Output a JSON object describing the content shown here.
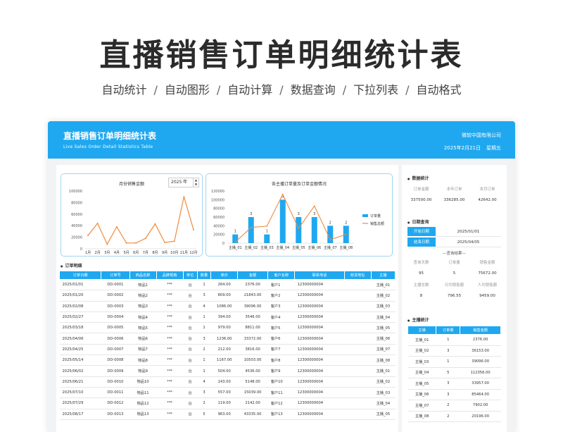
{
  "hero": {
    "title": "直播销售订单明细统计表",
    "features": [
      "自动统计",
      "自动图形",
      "自动计算",
      "数据查询",
      "下拉列表",
      "自动格式"
    ],
    "separator": "/"
  },
  "header": {
    "title": "直播销售订单明细统计表",
    "subtitle": "Live Sales Order Detail Statistics Table",
    "company": "微软中国有限公司",
    "date": "2025年2月21日",
    "weekday": "星期五"
  },
  "monthly_chart": {
    "title": "月份销售金额",
    "year_value": "2025 年"
  },
  "anchor_chart": {
    "title": "各主播订单量及订单金额情况",
    "legend_bar": "订单量",
    "legend_line": "销售总额"
  },
  "chart_data": [
    {
      "type": "line",
      "title": "月份销售金额",
      "categories": [
        "1月",
        "2月",
        "3月",
        "4月",
        "5月",
        "6月",
        "7月",
        "8月",
        "9月",
        "10月",
        "11月",
        "12月"
      ],
      "series": [
        {
          "values": [
            23000,
            44000,
            8000,
            38000,
            10000,
            10000,
            18000,
            43000,
            11000,
            13000,
            90000,
            33000
          ]
        }
      ],
      "yticks": [
        "100000",
        "80000",
        "60000",
        "40000",
        "20000",
        "0"
      ],
      "ylim": [
        0,
        100000
      ],
      "color": "#f08a3c"
    },
    {
      "type": "bar",
      "title": "各主播订单量及订单金额情况",
      "categories": [
        "主播_01",
        "主播_02",
        "主播_03",
        "主播_04",
        "主播_05",
        "主播_06",
        "主播_07",
        "主播_08"
      ],
      "series": [
        {
          "name": "订单量",
          "type": "bar",
          "values": [
            1,
            3,
            1,
            5,
            3,
            3,
            2,
            2
          ],
          "axis": "right",
          "color": "#1fa8f0"
        },
        {
          "name": "销售总额",
          "type": "line",
          "values": [
            2376,
            36153,
            39096,
            112356,
            33957,
            85464,
            7902,
            20196
          ],
          "axis": "left",
          "color": "#f08a3c"
        }
      ],
      "yticks": [
        "120000",
        "100000",
        "80000",
        "60000",
        "40000",
        "20000",
        "0"
      ],
      "ylim": [
        0,
        120000
      ],
      "y2lim": [
        0,
        6
      ]
    }
  ],
  "detail": {
    "section_title": "订单明细",
    "columns": [
      "订单日期",
      "订单号",
      "商品名称",
      "品牌规格",
      "单位",
      "数量",
      "单价",
      "金额",
      "客户名称",
      "联系电话",
      "收货地址",
      "主播"
    ],
    "rows": [
      [
        "2025/01/01",
        "DD-0001",
        "物品1",
        "***",
        "台",
        "1",
        "264.00",
        "2376.00",
        "客户1",
        "12300000004",
        "",
        "主播_01"
      ],
      [
        "2025/01/20",
        "DD-0002",
        "物品2",
        "***",
        "台",
        "3",
        "809.00",
        "21843.00",
        "客户2",
        "12300000004",
        "",
        "主播_02"
      ],
      [
        "2025/02/08",
        "DD-0003",
        "物品3",
        "***",
        "台",
        "4",
        "1086.00",
        "39096.00",
        "客户3",
        "12300000004",
        "",
        "主播_03"
      ],
      [
        "2025/02/27",
        "DD-0004",
        "物品4",
        "***",
        "台",
        "1",
        "394.00",
        "3546.00",
        "客户4",
        "12300000004",
        "",
        "主播_04"
      ],
      [
        "2025/03/18",
        "DD-0005",
        "物品5",
        "***",
        "台",
        "1",
        "979.00",
        "8811.00",
        "客户5",
        "12300000004",
        "",
        "主播_05"
      ],
      [
        "2025/04/06",
        "DD-0006",
        "物品6",
        "***",
        "台",
        "3",
        "1236.00",
        "33372.00",
        "客户6",
        "12300000004",
        "",
        "主播_06"
      ],
      [
        "2025/04/25",
        "DD-0007",
        "物品7",
        "***",
        "台",
        "2",
        "212.00",
        "3816.00",
        "客户7",
        "12300000004",
        "",
        "主播_07"
      ],
      [
        "2025/05/14",
        "DD-0008",
        "物品8",
        "***",
        "台",
        "1",
        "1167.00",
        "10503.00",
        "客户8",
        "12300000004",
        "",
        "主播_08"
      ],
      [
        "2025/06/02",
        "DD-0009",
        "物品9",
        "***",
        "台",
        "1",
        "504.00",
        "4536.00",
        "客户9",
        "12300000004",
        "",
        "主播_01"
      ],
      [
        "2025/06/21",
        "DD-0010",
        "物品10",
        "***",
        "台",
        "4",
        "143.00",
        "5148.00",
        "客户10",
        "12300000004",
        "",
        "主播_02"
      ],
      [
        "2025/07/10",
        "DD-0011",
        "物品11",
        "***",
        "台",
        "3",
        "557.00",
        "15039.00",
        "客户11",
        "12300000004",
        "",
        "主播_03"
      ],
      [
        "2025/07/29",
        "DD-0012",
        "物品12",
        "***",
        "台",
        "2",
        "119.00",
        "2142.00",
        "客户12",
        "12300000004",
        "",
        "主播_04"
      ],
      [
        "2025/08/17",
        "DD-0013",
        "物品13",
        "***",
        "台",
        "5",
        "963.00",
        "43335.00",
        "客户13",
        "12300000004",
        "",
        "主播_05"
      ]
    ]
  },
  "data_stats": {
    "title": "数据统计",
    "labels": [
      "订单金额",
      "本年订单",
      "本月订单"
    ],
    "values": [
      "337500.00",
      "336285.00",
      "42642.00"
    ]
  },
  "date_query": {
    "title": "日期查询",
    "start_label": "开始日期",
    "start_value": "2025/01/01",
    "end_label": "结束日期",
    "end_value": "2025/04/05",
    "result_title": "—查询结果—",
    "labels1": [
      "查询天数",
      "订单量",
      "销售金额"
    ],
    "values1": [
      "95",
      "5",
      "75672.00"
    ],
    "labels2": [
      "主播总数",
      "日均销售额",
      "人均销售额"
    ],
    "values2": [
      "8",
      "796.55",
      "9459.00"
    ]
  },
  "anchor_stats": {
    "title": "主播统计",
    "columns": [
      "主播",
      "订单量",
      "销售金额"
    ],
    "rows": [
      [
        "主播_01",
        "1",
        "2376.00"
      ],
      [
        "主播_02",
        "3",
        "36153.00"
      ],
      [
        "主播_03",
        "1",
        "39096.00"
      ],
      [
        "主播_04",
        "5",
        "112356.00"
      ],
      [
        "主播_05",
        "3",
        "33957.00"
      ],
      [
        "主播_06",
        "3",
        "85464.00"
      ],
      [
        "主播_07",
        "2",
        "7902.00"
      ],
      [
        "主播_08",
        "2",
        "20196.00"
      ]
    ]
  }
}
